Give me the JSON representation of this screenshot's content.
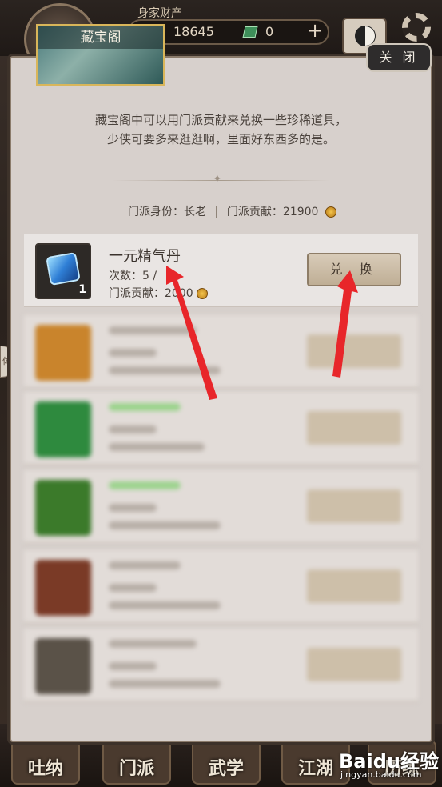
{
  "hud": {
    "wealth_label": "身家财产",
    "wealth_value": "18645",
    "jade_value": "0",
    "plus": "+"
  },
  "panel": {
    "title": "藏宝阁",
    "close_label": "关 闭",
    "intro_line1": "藏宝阁中可以用门派贡献来兑换一些珍稀道具，",
    "intro_line2": "少侠可要多来逛逛啊，里面好东西多的是。",
    "status_identity": "门派身份：长老",
    "status_contribution": "门派贡献：21900"
  },
  "featured_item": {
    "name": "一元精气丹",
    "count": "次数：5 /",
    "cost": "门派贡献：2000",
    "quantity": "1",
    "exchange_label": "兑 换"
  },
  "blurred_items": [
    {
      "icon_color": "#c9842c"
    },
    {
      "icon_color": "#2e8a3e"
    },
    {
      "icon_color": "#3b7a2a"
    },
    {
      "icon_color": "#7a3a26"
    },
    {
      "icon_color": "#5a5248"
    }
  ],
  "bottom_nav": [
    {
      "label": "吐纳"
    },
    {
      "label": "门派"
    },
    {
      "label": "武学"
    },
    {
      "label": "江湖"
    },
    {
      "label": "历练"
    }
  ],
  "side_tab": "体",
  "watermark": {
    "brand": "Baidu经验",
    "url": "jingyan.baidu.com"
  },
  "colors": {
    "accent_red": "#e8262a",
    "panel_bg": "#d7d0cc",
    "button_bg": "#cdbfa9"
  }
}
